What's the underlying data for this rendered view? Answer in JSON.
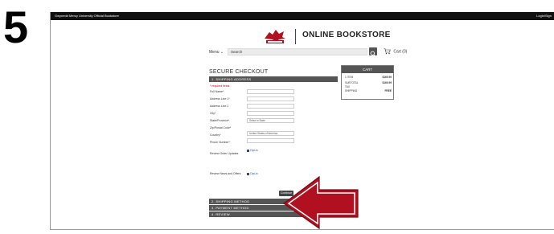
{
  "step_number": "5",
  "topbar": {
    "university": "Gwynedd Mercy University Official Bookstore",
    "login": "Login/Sign"
  },
  "header": {
    "store_name": "ONLINE BOOKSTORE",
    "menu_label": "Menu",
    "search_placeholder": "Search",
    "cart_label": "Cart (0)"
  },
  "checkout": {
    "title": "SECURE CHECKOUT",
    "required_note": "* required fields",
    "sections": {
      "shipping_address": "1. SHIPPING ADDRESS",
      "shipping_method": "2. SHIPPING METHOD",
      "payment_method": "3. PAYMENT METHOD",
      "review": "4. REVIEW"
    },
    "fields": [
      {
        "label": "Full Name*",
        "value": ""
      },
      {
        "label": "Address Line 1*",
        "value": ""
      },
      {
        "label": "Address Line 2",
        "value": ""
      },
      {
        "label": "City*",
        "value": ""
      },
      {
        "label": "State/Province*",
        "value": "Select a State"
      },
      {
        "label": "Zip/Postal Code*",
        "value": ""
      },
      {
        "label": "Country*",
        "value": "United States of America"
      },
      {
        "label": "Phone Number*",
        "value": ""
      }
    ],
    "review_updates": {
      "label": "Review Order Updates",
      "optin": "Opt-in",
      "text": ""
    },
    "review_news": {
      "label": "Review News and Offers",
      "optin": "Opt-in",
      "text": ""
    },
    "continue_label": "Continue"
  },
  "cart": {
    "title": "CART",
    "rows": [
      {
        "label": "1 ITEM",
        "value": "$169.99"
      },
      {
        "label": "SUBTOTAL",
        "value": "$169.99"
      },
      {
        "label": "TAX",
        "value": ""
      },
      {
        "label": "SHIPPING",
        "value": "FREE"
      }
    ]
  },
  "colors": {
    "arrow": "#b01020",
    "section_bar": "#555555",
    "brand_red": "#b01020"
  },
  "icons": [
    "menu-chevron-icon",
    "search-icon",
    "cart-icon",
    "griffin-logo-icon",
    "callout-arrow-icon"
  ]
}
